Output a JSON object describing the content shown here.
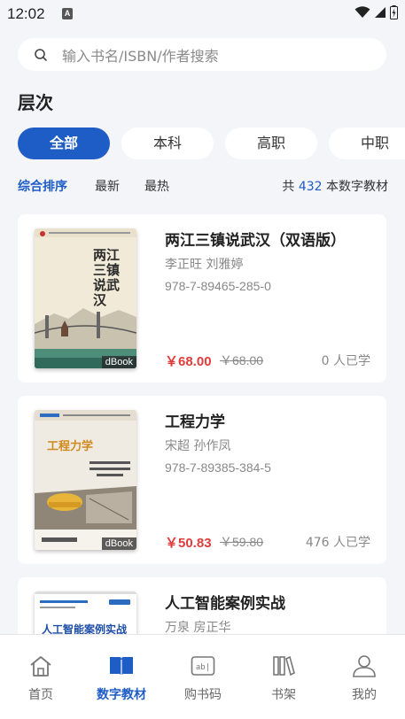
{
  "status": {
    "time": "12:02",
    "notification_letter": "A"
  },
  "search": {
    "placeholder": "输入书名/ISBN/作者搜索"
  },
  "filter": {
    "title": "层次",
    "chips": [
      "全部",
      "本科",
      "高职",
      "中职"
    ],
    "active_index": 0
  },
  "sort": {
    "options": [
      "综合排序",
      "最新",
      "最热"
    ],
    "active_index": 0,
    "count_prefix": "共",
    "count": "432",
    "count_suffix": "本数字教材"
  },
  "books": [
    {
      "title": "两江三镇说武汉（双语版）",
      "authors": "李正旺 刘雅婷",
      "isbn": "978-7-89465-285-0",
      "price": "￥68.00",
      "old_price": "￥68.00",
      "buyers": "0 人已学",
      "badge": "dBook",
      "cover_text": "两江三镇说武汉"
    },
    {
      "title": "工程力学",
      "authors": "宋超 孙作凤",
      "isbn": "978-7-89385-384-5",
      "price": "￥50.83",
      "old_price": "￥59.80",
      "buyers": "476 人已学",
      "badge": "dBook",
      "cover_text": "工程力学"
    },
    {
      "title": "人工智能案例实战",
      "authors": "万泉 房正华",
      "cover_text": "人工智能案例实战"
    }
  ],
  "tabs": [
    {
      "label": "首页",
      "icon": "home-icon"
    },
    {
      "label": "数字教材",
      "icon": "book-open-icon"
    },
    {
      "label": "购书码",
      "icon": "code-icon"
    },
    {
      "label": "书架",
      "icon": "bookshelf-icon"
    },
    {
      "label": "我的",
      "icon": "user-icon"
    }
  ],
  "active_tab": 1,
  "colors": {
    "accent": "#1e5cc6",
    "price": "#e03c3c",
    "background": "#f3f5f9"
  }
}
